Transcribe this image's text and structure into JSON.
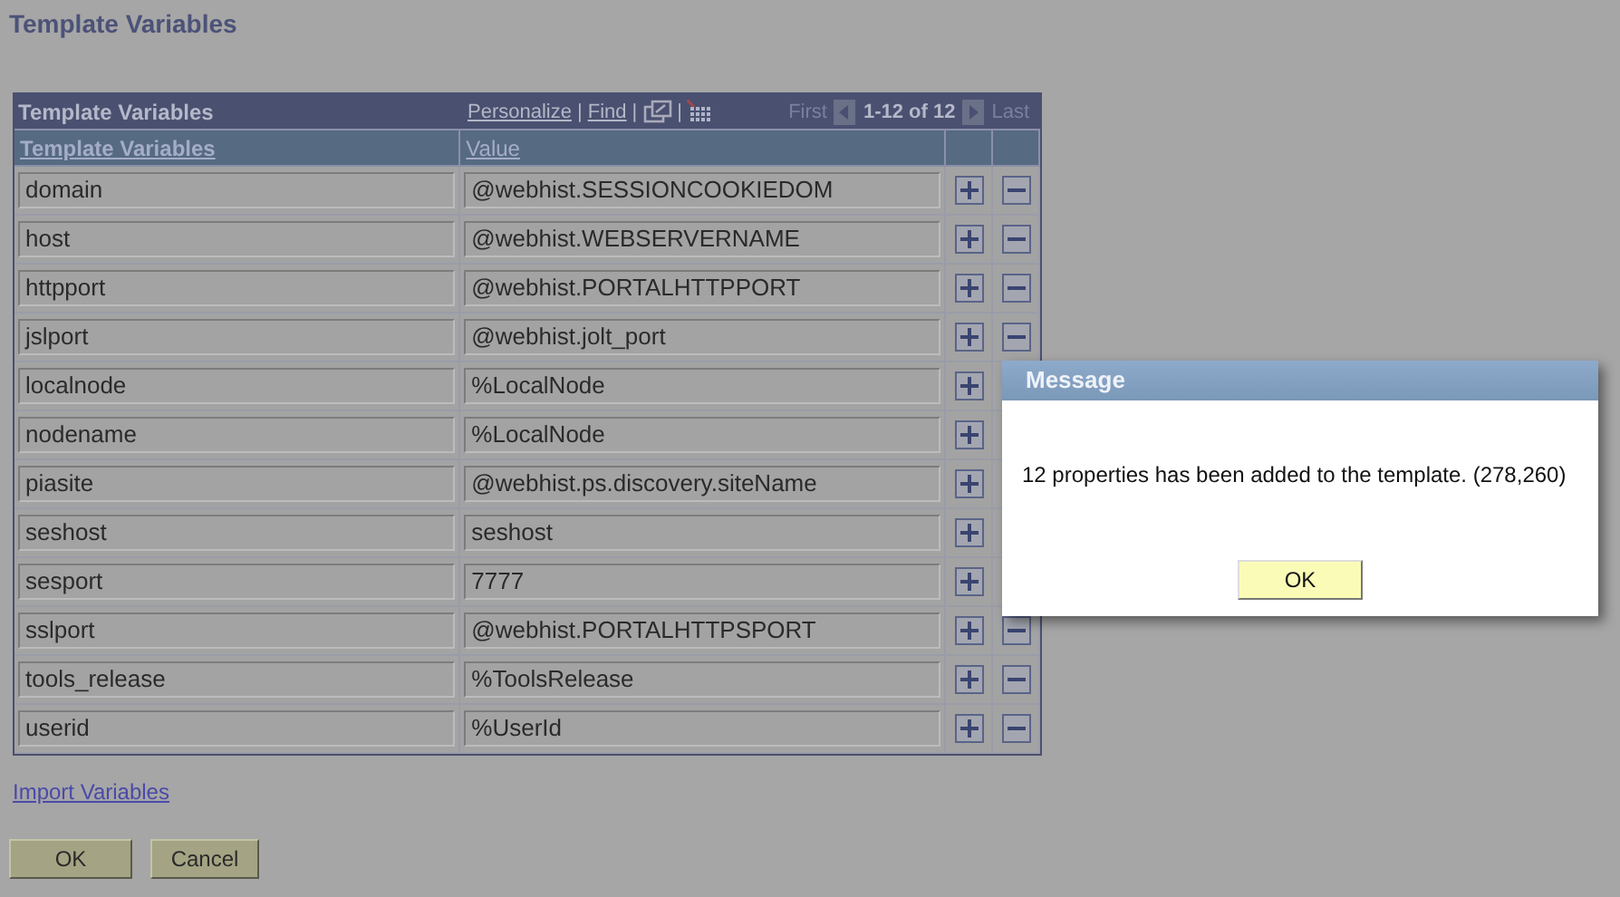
{
  "page_title": "Template Variables",
  "grid": {
    "title": "Template Variables",
    "toolbar": [
      {
        "kind": "link",
        "text": "Personalize"
      },
      {
        "kind": "separator",
        "text": "|"
      },
      {
        "kind": "link",
        "text": "Find"
      },
      {
        "kind": "separator",
        "text": "|"
      },
      {
        "kind": "window_icon"
      },
      {
        "kind": "separator",
        "text": "|"
      },
      {
        "kind": "grid_icon"
      }
    ],
    "nav": {
      "first": "First",
      "range": "1-12 of 12",
      "last": "Last"
    },
    "columns": [
      "Template Variables",
      "Value"
    ],
    "rows": [
      {
        "name": "domain",
        "value": "@webhist.SESSIONCOOKIEDOM"
      },
      {
        "name": "host",
        "value": "@webhist.WEBSERVERNAME"
      },
      {
        "name": "httpport",
        "value": "@webhist.PORTALHTTPPORT"
      },
      {
        "name": "jslport",
        "value": "@webhist.jolt_port"
      },
      {
        "name": "localnode",
        "value": "%LocalNode"
      },
      {
        "name": "nodename",
        "value": "%LocalNode"
      },
      {
        "name": "piasite",
        "value": "@webhist.ps.discovery.siteName"
      },
      {
        "name": "seshost",
        "value": "seshost"
      },
      {
        "name": "sesport",
        "value": "7777"
      },
      {
        "name": "sslport",
        "value": "@webhist.PORTALHTTPSPORT"
      },
      {
        "name": "tools_release",
        "value": "%ToolsRelease"
      },
      {
        "name": "userid",
        "value": "%UserId"
      }
    ]
  },
  "import_link": "Import Variables",
  "buttons": [
    "OK",
    "Cancel"
  ],
  "dialog": {
    "title": "Message",
    "text": "12 properties has been added to the template. (278,260)",
    "button": "OK"
  }
}
